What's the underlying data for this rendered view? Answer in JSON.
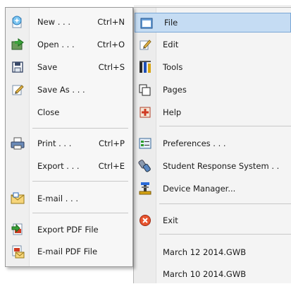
{
  "file_submenu": {
    "items": [
      {
        "label": "New . . .",
        "shortcut": "Ctrl+N",
        "icon": "new-document-icon"
      },
      {
        "label": "Open . . .",
        "shortcut": "Ctrl+O",
        "icon": "open-folder-icon"
      },
      {
        "label": "Save",
        "shortcut": "Ctrl+S",
        "icon": "save-disk-icon"
      },
      {
        "label": "Save As . . .",
        "shortcut": "",
        "icon": "save-as-icon"
      },
      {
        "label": "Close",
        "shortcut": "",
        "icon": ""
      },
      {
        "label": "Print . . .",
        "shortcut": "Ctrl+P",
        "icon": "printer-icon"
      },
      {
        "label": "Export . . .",
        "shortcut": "Ctrl+E",
        "icon": ""
      },
      {
        "label": "E-mail . . .",
        "shortcut": "",
        "icon": "email-envelope-icon"
      },
      {
        "label": "Export PDF File",
        "shortcut": "",
        "icon": "export-pdf-icon"
      },
      {
        "label": "E-mail PDF File",
        "shortcut": "",
        "icon": "email-pdf-icon"
      }
    ]
  },
  "main_menu": {
    "selected": "File",
    "items": [
      {
        "label": "File",
        "icon": "file-icon"
      },
      {
        "label": "Edit",
        "icon": "edit-pencil-icon"
      },
      {
        "label": "Tools",
        "icon": "tools-icon"
      },
      {
        "label": "Pages",
        "icon": "pages-icon"
      },
      {
        "label": "Help",
        "icon": "help-icon"
      },
      {
        "label": "Preferences . . .",
        "icon": "preferences-icon"
      },
      {
        "label": "Student Response System . .",
        "icon": "student-response-icon"
      },
      {
        "label": "Device Manager...",
        "icon": "device-manager-icon"
      },
      {
        "label": "Exit",
        "icon": "exit-icon"
      },
      {
        "label": "March 12 2014.GWB",
        "icon": ""
      },
      {
        "label": "March 10 2014.GWB",
        "icon": ""
      }
    ]
  },
  "colors": {
    "selection_fill": "#c5dcf3",
    "selection_border": "#7aa7d6",
    "menu_background": "#f4f4f4"
  }
}
